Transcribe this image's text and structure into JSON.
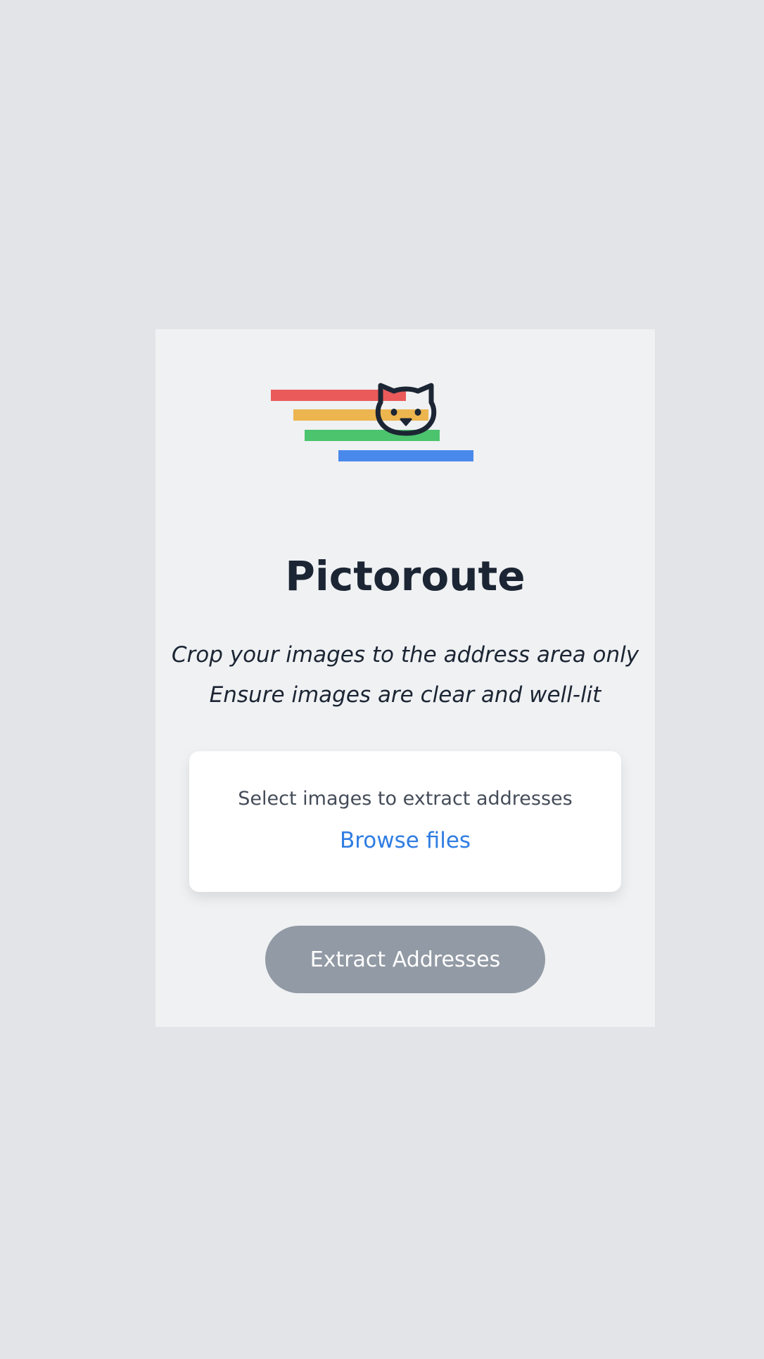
{
  "app": {
    "title": "Pictoroute",
    "logo_icon": "cat-icon",
    "tips": [
      "Crop your images to the address area only",
      "Ensure images are clear and well-lit"
    ]
  },
  "uploader": {
    "prompt": "Select images to extract addresses",
    "browse_label": "Browse files"
  },
  "actions": {
    "extract_label": "Extract Addresses",
    "extract_enabled": false
  },
  "colors": {
    "background": "#e2e4e8",
    "card": "#eff1f3",
    "stripe_red": "#ea5a5a",
    "stripe_yellow": "#ecb54e",
    "stripe_green": "#4cc46e",
    "stripe_blue": "#4a89ec",
    "link": "#2f7de2",
    "button_disabled": "#929aa5",
    "text_dark": "#1c2533"
  }
}
